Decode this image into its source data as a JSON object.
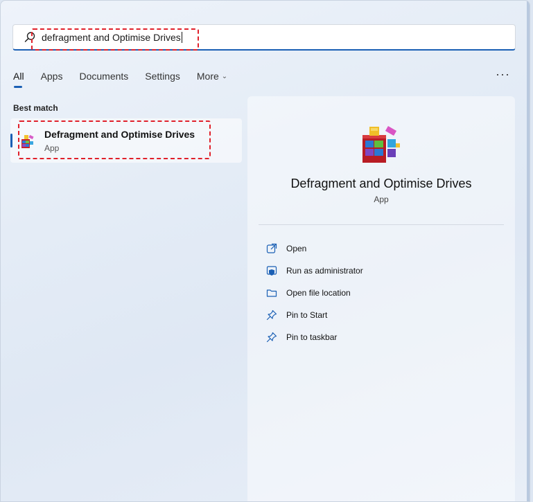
{
  "search": {
    "query": "defragment and Optimise Drives",
    "icon": "search-icon"
  },
  "tabs": [
    {
      "label": "All",
      "active": true
    },
    {
      "label": "Apps"
    },
    {
      "label": "Documents"
    },
    {
      "label": "Settings"
    },
    {
      "label": "More"
    }
  ],
  "more_menu_icon": "ellipsis-icon",
  "best_match": {
    "heading": "Best match",
    "title": "Defragment and Optimise Drives",
    "subtitle": "App",
    "icon": "defrag-app-icon"
  },
  "detail": {
    "title": "Defragment and Optimise Drives",
    "subtitle": "App",
    "actions": [
      {
        "label": "Open",
        "icon": "open-external-icon"
      },
      {
        "label": "Run as administrator",
        "icon": "shield-admin-icon"
      },
      {
        "label": "Open file location",
        "icon": "folder-icon"
      },
      {
        "label": "Pin to Start",
        "icon": "pin-icon"
      },
      {
        "label": "Pin to taskbar",
        "icon": "pin-icon"
      }
    ]
  },
  "colors": {
    "accent": "#1a5fb4",
    "highlight": "#e0202a"
  }
}
